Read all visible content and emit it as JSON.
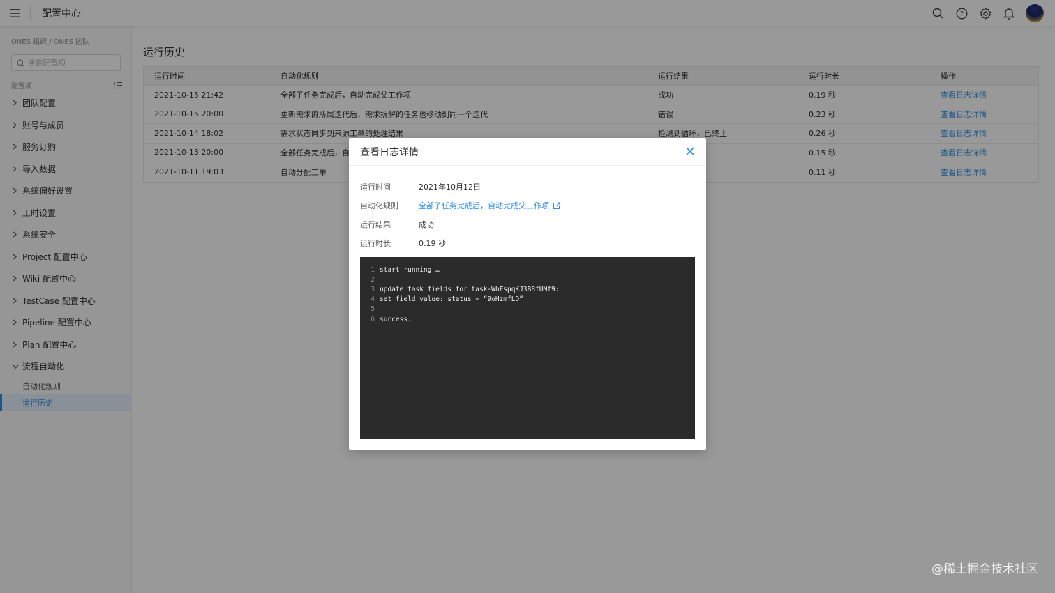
{
  "app": {
    "title": "配置中心"
  },
  "topbar": {
    "icons": [
      "search-icon",
      "help-icon",
      "gear-icon",
      "bell-icon",
      "avatar"
    ]
  },
  "sidebar": {
    "breadcrumb": "ONES 组织 / ONES 团队",
    "search_placeholder": "搜索配置项",
    "section_label": "配置项",
    "items": [
      {
        "label": "团队配置"
      },
      {
        "label": "账号与成员"
      },
      {
        "label": "服务订购"
      },
      {
        "label": "导入数据"
      },
      {
        "label": "系统偏好设置"
      },
      {
        "label": "工时设置"
      },
      {
        "label": "系统安全"
      },
      {
        "label": "Project 配置中心"
      },
      {
        "label": "Wiki 配置中心"
      },
      {
        "label": "TestCase 配置中心"
      },
      {
        "label": "Pipeline 配置中心"
      },
      {
        "label": "Plan 配置中心"
      },
      {
        "label": "流程自动化"
      }
    ],
    "sub_items": [
      {
        "label": "自动化规则"
      },
      {
        "label": "运行历史"
      }
    ]
  },
  "main": {
    "title": "运行历史",
    "columns": [
      "运行时间",
      "自动化规则",
      "运行结果",
      "运行时长",
      "操作"
    ],
    "rows": [
      {
        "time": "2021-10-15 21:42",
        "rule": "全部子任务完成后，自动完成父工作项",
        "result": "成功",
        "duration": "0.19 秒",
        "action": "查看日志详情"
      },
      {
        "time": "2021-10-15 20:00",
        "rule": "更新需求的所属迭代后，需求拆解的任务也移动到同一个迭代",
        "result": "错误",
        "duration": "0.23 秒",
        "action": "查看日志详情"
      },
      {
        "time": "2021-10-14 18:02",
        "rule": "需求状态同步到来源工单的处理结果",
        "result": "检测到循环，已终止",
        "duration": "0.26 秒",
        "action": "查看日志详情"
      },
      {
        "time": "2021-10-13 20:00",
        "rule": "全部任务完成后，自",
        "result": "",
        "duration": "0.15 秒",
        "action": "查看日志详情"
      },
      {
        "time": "2021-10-11 19:03",
        "rule": "自动分配工单",
        "result": "",
        "duration": "0.11 秒",
        "action": "查看日志详情"
      }
    ]
  },
  "modal": {
    "title": "查看日志详情",
    "fields": {
      "time_label": "运行时间",
      "time_value": "2021年10月12日",
      "rule_label": "自动化规则",
      "rule_value": "全部子任务完成后，自动完成父工作项",
      "result_label": "运行结果",
      "result_value": "成功",
      "duration_label": "运行时长",
      "duration_value": "0.19 秒"
    },
    "log_lines": [
      {
        "n": "1",
        "text": "start running …"
      },
      {
        "n": "2",
        "text": ""
      },
      {
        "n": "3",
        "text": "update_task_fields for task-WhFspqKJ3B8fUMf9:"
      },
      {
        "n": "4",
        "text": "set field value: status = “9oHzmfLD”"
      },
      {
        "n": "5",
        "text": ""
      },
      {
        "n": "6",
        "text": "success."
      }
    ]
  },
  "watermark": "@稀土掘金技术社区",
  "colors": {
    "accent": "#338fe5",
    "code_bg": "#2b2b2b"
  }
}
